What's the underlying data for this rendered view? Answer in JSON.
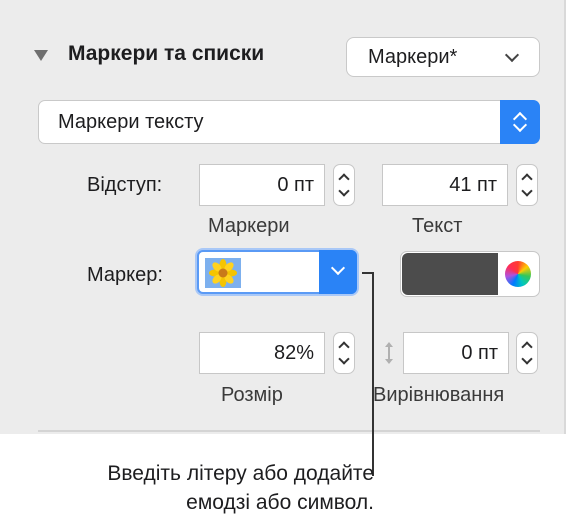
{
  "section": {
    "title": "Маркери та списки",
    "style_menu": "Маркери*"
  },
  "list_type_popup": {
    "value": "Маркери тексту"
  },
  "indent": {
    "label": "Відступ:",
    "markers_value": "0 пт",
    "markers_label": "Маркери",
    "text_value": "41 пт",
    "text_label": "Текст"
  },
  "marker": {
    "label": "Маркер:",
    "icon": "sunflower-emoji",
    "color": "#4c4c4c"
  },
  "size": {
    "value": "82%",
    "label": "Розмір"
  },
  "alignment": {
    "value": "0 пт",
    "label": "Вирівнювання"
  },
  "callout": {
    "line1": "Введіть літеру або додайте",
    "line2": "емодзі або символ."
  }
}
